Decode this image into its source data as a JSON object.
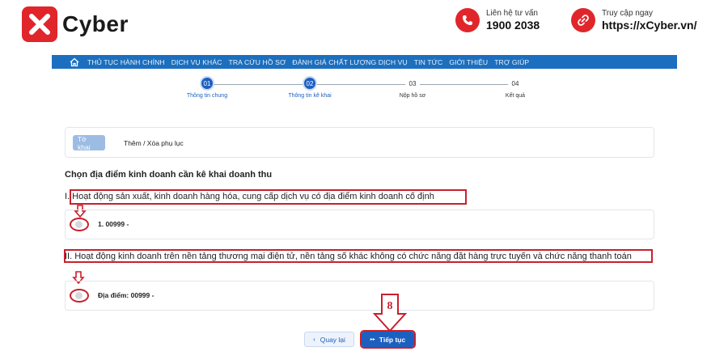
{
  "brand": {
    "name": "Cyber",
    "tm": "TM",
    "accent": "#e0262b"
  },
  "contact": {
    "phone_label": "Liên hệ tư vấn",
    "phone_value": "1900 2038",
    "web_label": "Truy cập ngay",
    "web_value": "https://xCyber.vn/"
  },
  "nav": {
    "color": "#1c6fbe",
    "items": [
      "THỦ TỤC HÀNH CHÍNH",
      "DỊCH VỤ KHÁC",
      "TRA CỨU HỒ SƠ",
      "ĐÁNH GIÁ CHẤT LƯỢNG DỊCH VỤ",
      "TIN TỨC",
      "GIỚI THIỆU",
      "TRỢ GIÚP"
    ]
  },
  "steps": [
    {
      "num": "01",
      "label": "Thông tin chung",
      "state": "active"
    },
    {
      "num": "02",
      "label": "Thông tin kê khai",
      "state": "active"
    },
    {
      "num": "03",
      "label": "Nộp hồ sơ",
      "state": "idle"
    },
    {
      "num": "04",
      "label": "Kết quả",
      "state": "idle"
    }
  ],
  "tabs": {
    "active": "Tờ khai",
    "other": "Thêm / Xóa phụ lục"
  },
  "heading": "Chọn địa điểm kinh doanh cần kê khai doanh thu",
  "section1": {
    "title": "I. Hoạt động sản xuất, kinh doanh hàng hóa, cung cấp dịch vụ có địa điểm kinh doanh cố định",
    "option": "1. 00999 -"
  },
  "section2": {
    "title": "II. Hoạt động kinh doanh trên nền tảng thương mại điện tử, nền tảng số khác không có chức năng đặt hàng trực tuyến và chức năng thanh toán",
    "option": "Địa điểm: 00999 -"
  },
  "buttons": {
    "back": "Quay lại",
    "next": "Tiếp tục"
  },
  "annotation": {
    "step_number": "8",
    "color": "#c8202e"
  }
}
